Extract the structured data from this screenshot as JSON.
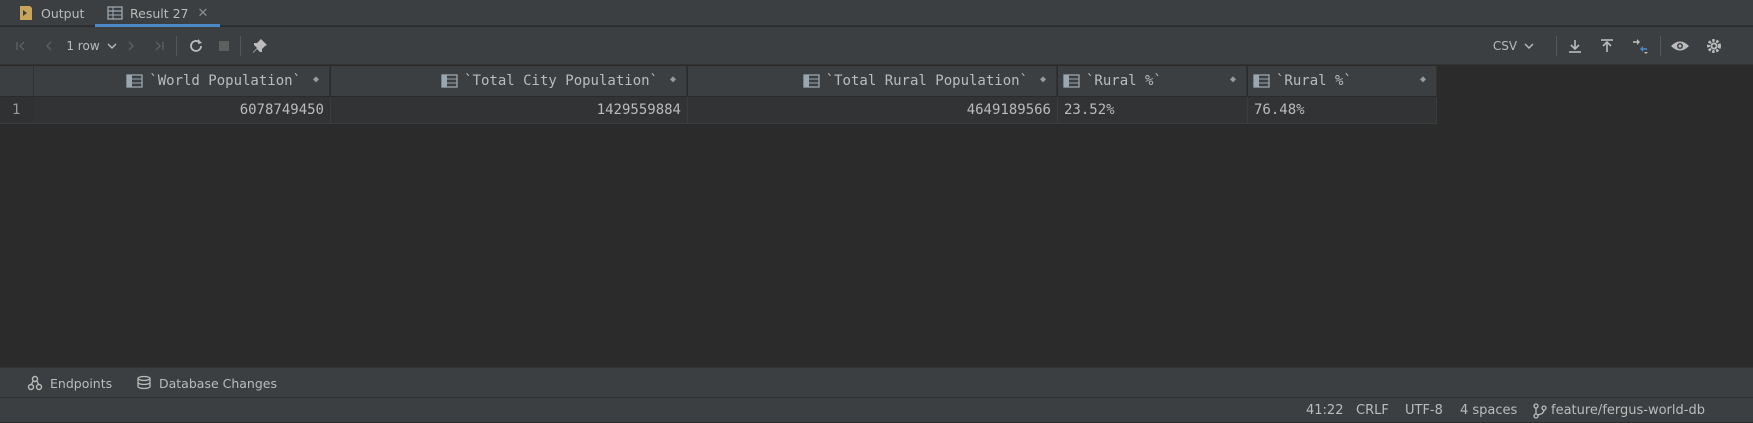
{
  "tabs": {
    "output_label": "Output",
    "result_label": "Result 27"
  },
  "toolbar": {
    "rows_label": "1 row",
    "export_format": "CSV"
  },
  "table": {
    "columns": [
      "`World Population`",
      "`Total City Population`",
      "`Total Rural Population`",
      "`Rural %`",
      "`Rural %`"
    ],
    "rows": [
      {
        "index": "1",
        "cells": [
          "6078749450",
          "1429559884",
          "4649189566",
          "23.52%",
          "76.48%"
        ]
      }
    ]
  },
  "tool_windows": {
    "endpoints_label": "Endpoints",
    "database_changes_label": "Database Changes"
  },
  "status": {
    "position": "41:22",
    "line_separator": "CRLF",
    "encoding": "UTF-8",
    "indent": "4 spaces",
    "branch": "feature/fergus-world-db"
  },
  "colors": {
    "accent": "#4a88c7",
    "background": "#2b2b2b",
    "panel": "#3c3f41"
  }
}
